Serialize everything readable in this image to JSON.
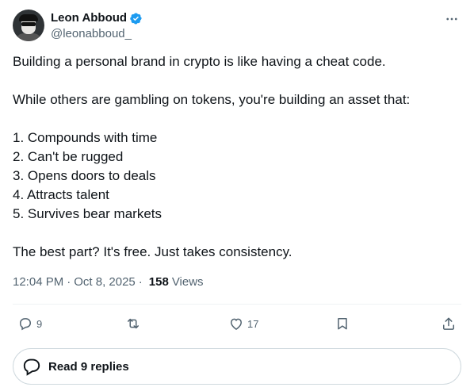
{
  "author": {
    "display_name": "Leon Abboud",
    "handle": "@leonabboud_",
    "verified_color": "#1d9bf0"
  },
  "tweet": {
    "lines_intro": [
      "Building a personal brand in crypto is like having a cheat code.",
      "While others are gambling on tokens, you're building an asset that:"
    ],
    "list": [
      "1. Compounds with time",
      "2. Can't be rugged",
      "3. Opens doors to deals",
      "4. Attracts talent",
      "5. Survives bear markets"
    ],
    "closing": "The best part? It's free. Just takes consistency."
  },
  "meta": {
    "time": "12:04 PM",
    "separator": "·",
    "date": "Oct 8, 2025",
    "views_count": "158",
    "views_label": "Views"
  },
  "actions": {
    "reply_count": "9",
    "retweet_count": "",
    "like_count": "17"
  },
  "replies": {
    "label": "Read 9 replies"
  },
  "icons": {
    "more": "more-horizontal-icon",
    "verified": "verified-badge-icon",
    "reply": "reply-icon",
    "retweet": "retweet-icon",
    "like": "heart-icon",
    "bookmark": "bookmark-icon",
    "share": "share-icon",
    "replies_bubble": "chat-bubble-icon"
  }
}
